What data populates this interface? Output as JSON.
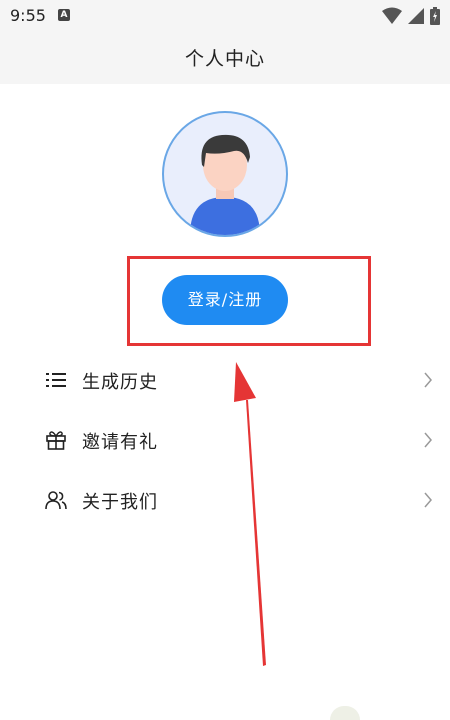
{
  "status_bar": {
    "time": "9:55",
    "notification_letter": "A",
    "icons": [
      "wifi-icon",
      "signal-icon",
      "battery-icon"
    ]
  },
  "header": {
    "title": "个人中心"
  },
  "profile": {
    "avatar_icon": "default-user-avatar",
    "login_button_label": "登录/注册"
  },
  "menu": {
    "items": [
      {
        "label": "生成历史",
        "icon": "list-icon"
      },
      {
        "label": "邀请有礼",
        "icon": "gift-icon"
      },
      {
        "label": "关于我们",
        "icon": "users-icon"
      }
    ]
  },
  "colors": {
    "accent": "#1f8bf2",
    "highlight": "#e53535",
    "header_bg": "#f5f5f5"
  }
}
